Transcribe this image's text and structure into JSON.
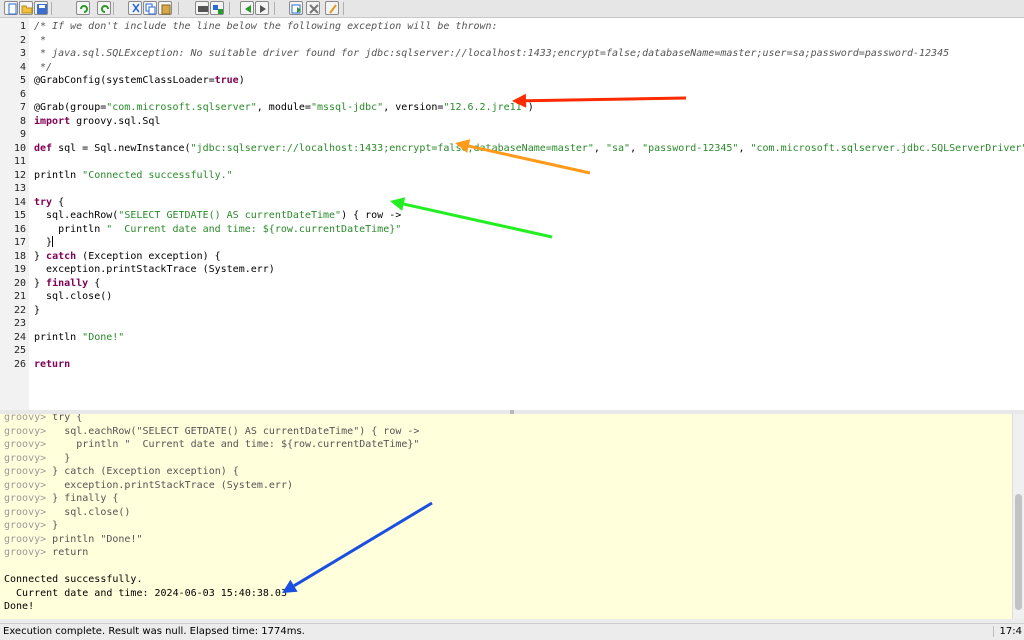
{
  "toolbar": {
    "buttons": [
      {
        "name": "new-file-icon"
      },
      {
        "name": "open-folder-icon"
      },
      {
        "name": "save-icon"
      },
      {
        "name": "undo-icon"
      },
      {
        "name": "redo-icon"
      },
      {
        "name": "cut-icon"
      },
      {
        "name": "copy-icon"
      },
      {
        "name": "paste-icon"
      },
      {
        "name": "find-icon"
      },
      {
        "name": "replace-icon"
      },
      {
        "name": "history-previous-icon"
      },
      {
        "name": "history-next-icon"
      },
      {
        "name": "run-script-icon"
      },
      {
        "name": "interrupt-icon"
      },
      {
        "name": "clear-output-icon"
      }
    ]
  },
  "editor": {
    "lines": [
      {
        "num": "1",
        "segments": [
          {
            "t": "/* If we don't include the line below the following exception will be thrown:",
            "c": "cm"
          }
        ]
      },
      {
        "num": "2",
        "segments": [
          {
            "t": " *",
            "c": "cm"
          }
        ]
      },
      {
        "num": "3",
        "segments": [
          {
            "t": " * java.sql.SQLException: No suitable driver found for jdbc:sqlserver://localhost:1433;encrypt=false;databaseName=master;user=sa;password=password-12345",
            "c": "cm"
          }
        ]
      },
      {
        "num": "4",
        "segments": [
          {
            "t": " */",
            "c": "cm"
          }
        ]
      },
      {
        "num": "5",
        "segments": [
          {
            "t": "@GrabConfig(systemClassLoader=",
            "c": ""
          },
          {
            "t": "true",
            "c": "kw"
          },
          {
            "t": ")",
            "c": ""
          }
        ]
      },
      {
        "num": "6",
        "segments": []
      },
      {
        "num": "7",
        "segments": [
          {
            "t": "@Grab(group=",
            "c": ""
          },
          {
            "t": "\"com.microsoft.sqlserver\"",
            "c": "str"
          },
          {
            "t": ", module=",
            "c": ""
          },
          {
            "t": "\"mssql-jdbc\"",
            "c": "str"
          },
          {
            "t": ", version=",
            "c": ""
          },
          {
            "t": "\"12.6.2.jre11\"",
            "c": "str"
          },
          {
            "t": ")",
            "c": ""
          }
        ]
      },
      {
        "num": "8",
        "segments": [
          {
            "t": "import",
            "c": "kw"
          },
          {
            "t": " groovy.sql.Sql",
            "c": ""
          }
        ]
      },
      {
        "num": "9",
        "segments": []
      },
      {
        "num": "10",
        "segments": [
          {
            "t": "def",
            "c": "kw"
          },
          {
            "t": " sql = Sql.newInstance(",
            "c": ""
          },
          {
            "t": "\"jdbc:sqlserver://localhost:1433;encrypt=false;databaseName=master\"",
            "c": "str"
          },
          {
            "t": ", ",
            "c": ""
          },
          {
            "t": "\"sa\"",
            "c": "str"
          },
          {
            "t": ", ",
            "c": ""
          },
          {
            "t": "\"password-12345\"",
            "c": "str"
          },
          {
            "t": ", ",
            "c": ""
          },
          {
            "t": "\"com.microsoft.sqlserver.jdbc.SQLServerDriver\"",
            "c": "str"
          },
          {
            "t": ")",
            "c": ""
          }
        ]
      },
      {
        "num": "11",
        "segments": []
      },
      {
        "num": "12",
        "segments": [
          {
            "t": "println ",
            "c": ""
          },
          {
            "t": "\"Connected successfully.\"",
            "c": "str"
          }
        ]
      },
      {
        "num": "13",
        "segments": []
      },
      {
        "num": "14",
        "segments": [
          {
            "t": "try",
            "c": "kw"
          },
          {
            "t": " {",
            "c": ""
          }
        ]
      },
      {
        "num": "15",
        "segments": [
          {
            "t": "  sql.eachRow(",
            "c": ""
          },
          {
            "t": "\"SELECT GETDATE() AS currentDateTime\"",
            "c": "str"
          },
          {
            "t": ") { row ->",
            "c": ""
          }
        ]
      },
      {
        "num": "16",
        "segments": [
          {
            "t": "    println ",
            "c": ""
          },
          {
            "t": "\"  Current date and time: ${row.currentDateTime}\"",
            "c": "str"
          }
        ]
      },
      {
        "num": "17",
        "segments": [
          {
            "t": "  }",
            "c": ""
          }
        ],
        "caret": true
      },
      {
        "num": "18",
        "segments": [
          {
            "t": "} ",
            "c": ""
          },
          {
            "t": "catch",
            "c": "kw"
          },
          {
            "t": " (Exception exception) {",
            "c": ""
          }
        ]
      },
      {
        "num": "19",
        "segments": [
          {
            "t": "  exception.printStackTrace (System.err)",
            "c": ""
          }
        ]
      },
      {
        "num": "20",
        "segments": [
          {
            "t": "} ",
            "c": ""
          },
          {
            "t": "finally",
            "c": "kw"
          },
          {
            "t": " {",
            "c": ""
          }
        ]
      },
      {
        "num": "21",
        "segments": [
          {
            "t": "  sql.close()",
            "c": ""
          }
        ]
      },
      {
        "num": "22",
        "segments": [
          {
            "t": "}",
            "c": ""
          }
        ]
      },
      {
        "num": "23",
        "segments": []
      },
      {
        "num": "24",
        "segments": [
          {
            "t": "println ",
            "c": ""
          },
          {
            "t": "\"Done!\"",
            "c": "str"
          }
        ]
      },
      {
        "num": "25",
        "segments": []
      },
      {
        "num": "26",
        "segments": [
          {
            "t": "return",
            "c": "kw"
          }
        ]
      }
    ]
  },
  "console": {
    "prompt": "groovy>",
    "echo": [
      "try {",
      "  sql.eachRow(\"SELECT GETDATE() AS currentDateTime\") { row ->",
      "    println \"  Current date and time: ${row.currentDateTime}\"",
      "  }",
      "} catch (Exception exception) {",
      "  exception.printStackTrace (System.err)",
      "} finally {",
      "  sql.close()",
      "}",
      "println \"Done!\"",
      "return"
    ],
    "output": [
      "Connected successfully.",
      "  Current date and time: 2024-06-03 15:40:38.03",
      "Done!"
    ]
  },
  "statusbar": {
    "message": "Execution complete. Result was null. Elapsed time: 1774ms.",
    "position": "17:4"
  },
  "annotations": {
    "colors": {
      "red": "#ff2a00",
      "orange": "#ff9a1a",
      "green": "#22ee22",
      "blue": "#1a4fe0"
    }
  }
}
